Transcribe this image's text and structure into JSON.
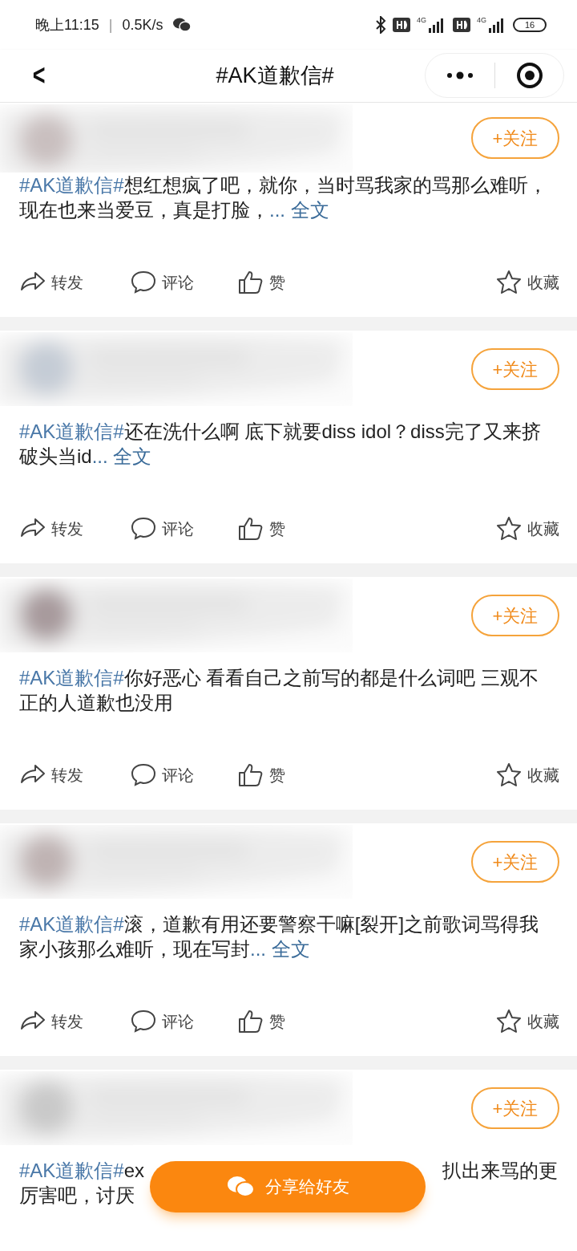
{
  "status_bar": {
    "time": "晚上11:15",
    "separator": "|",
    "speed": "0.5K/s",
    "net_1": "4G",
    "net_2": "4G",
    "battery": "16"
  },
  "nav": {
    "back": "<",
    "title": "#AK道歉信#"
  },
  "posts": [
    {
      "kind": "full",
      "follow": "+关注",
      "hashtag": "#AK道歉信#",
      "body": "想红想疯了吧，就你，当时骂我家的骂那么难听，现在也来当爱豆，真是打脸，",
      "more": "... 全文",
      "actions": [
        "转发",
        "评论",
        "赞",
        "收藏"
      ]
    },
    {
      "kind": "full",
      "follow": "+关注",
      "hashtag": "#AK道歉信#",
      "body": "还在洗什么啊 底下就要diss idol？diss完了又来挤破头当id",
      "more": "... 全文",
      "actions": [
        "转发",
        "评论",
        "赞",
        "收藏"
      ]
    },
    {
      "kind": "full",
      "follow": "+关注",
      "hashtag": "#AK道歉信#",
      "body": "你好恶心 看看自己之前写的都是什么词吧 三观不正的人道歉也没用",
      "actions": [
        "转发",
        "评论",
        "赞",
        "收藏"
      ]
    },
    {
      "kind": "full",
      "follow": "+关注",
      "hashtag": "#AK道歉信#",
      "body": "滚，道歉有用还要警察干嘛[裂开]之前歌词骂得我家小孩那么难听，现在写封",
      "more": "... 全文",
      "actions": [
        "转发",
        "评论",
        "赞",
        "收藏"
      ]
    },
    {
      "kind": "obscured",
      "follow": "+关注",
      "hashtag": "#AK道歉信#",
      "body_start": "ex",
      "body_end": "扒出来骂的更",
      "line_2": "厉害吧，讨厌"
    }
  ],
  "share_button": {
    "label": "分享给好友"
  }
}
